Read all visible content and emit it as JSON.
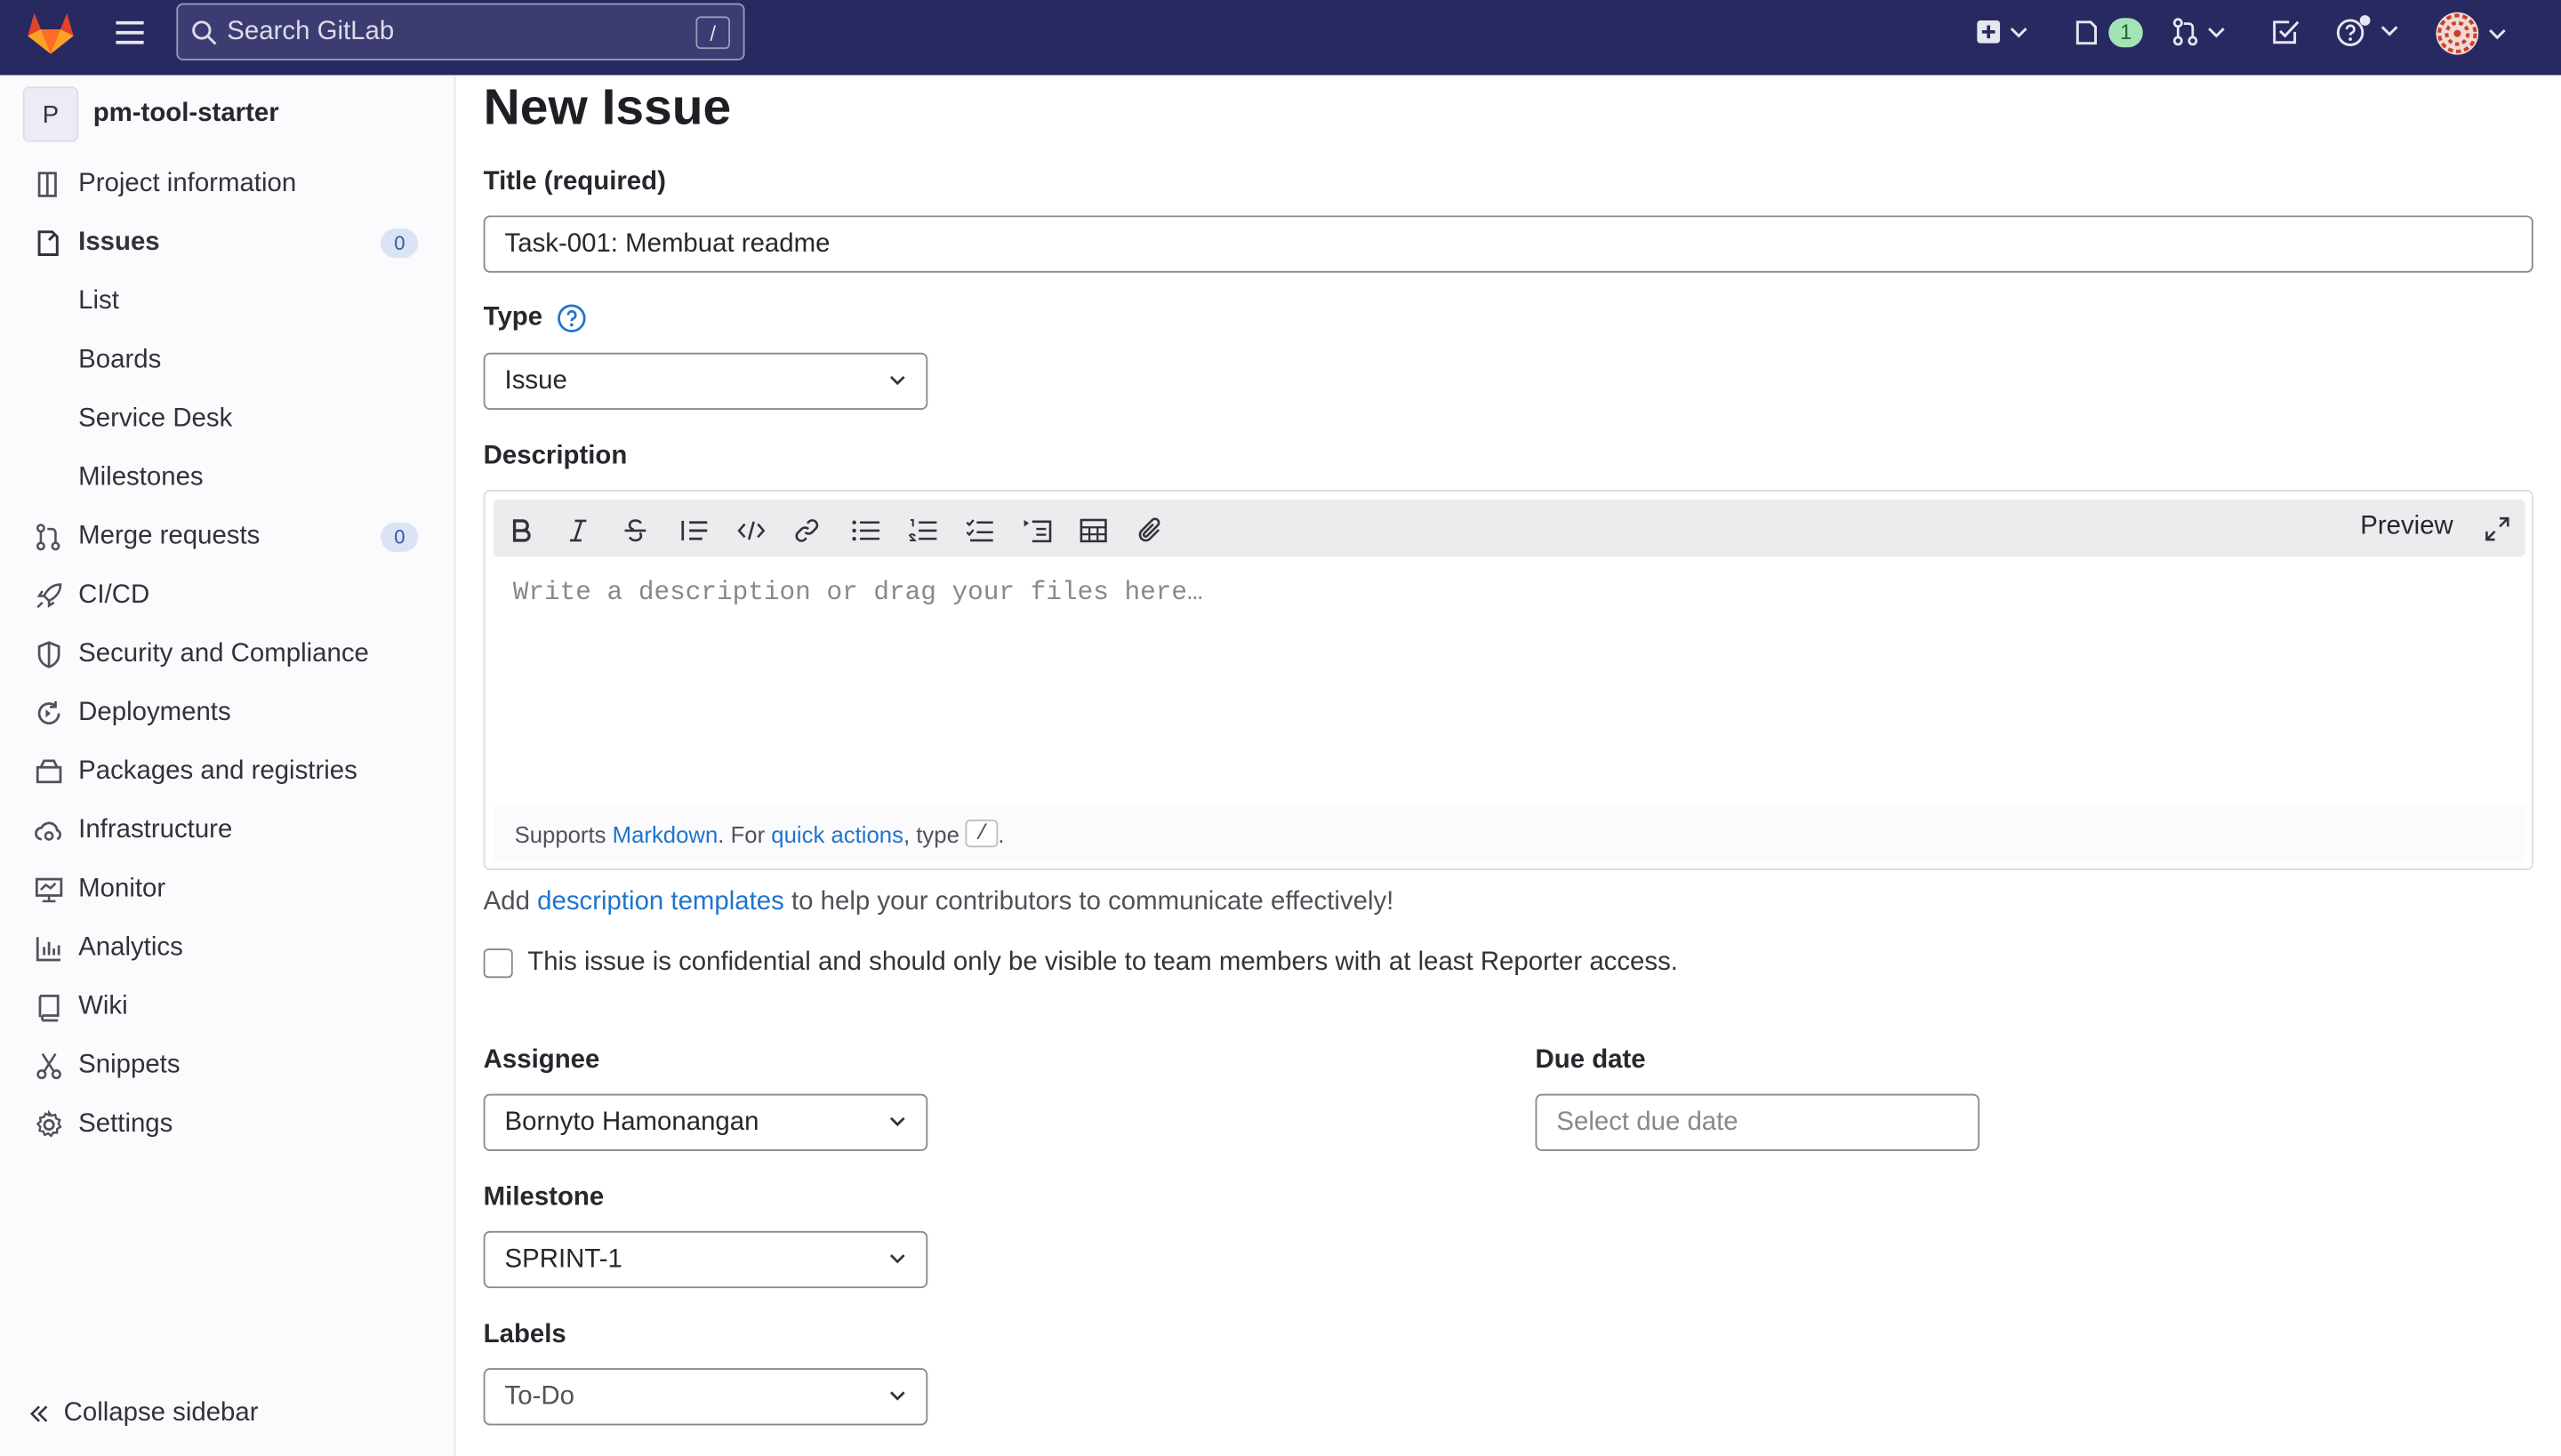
{
  "topbar": {
    "search_placeholder": "Search GitLab",
    "search_shortcut": "/",
    "issues_count": "1"
  },
  "sidebar": {
    "project_initial": "P",
    "project_name": "pm-tool-starter",
    "items": [
      {
        "label": "Project information",
        "icon": "project-info-icon"
      },
      {
        "label": "Issues",
        "icon": "issues-icon",
        "count": "0"
      },
      {
        "label": "List"
      },
      {
        "label": "Boards"
      },
      {
        "label": "Service Desk"
      },
      {
        "label": "Milestones"
      },
      {
        "label": "Merge requests",
        "icon": "merge-request-icon",
        "count": "0"
      },
      {
        "label": "CI/CD",
        "icon": "rocket-icon"
      },
      {
        "label": "Security and Compliance",
        "icon": "shield-icon"
      },
      {
        "label": "Deployments",
        "icon": "deployments-icon"
      },
      {
        "label": "Packages and registries",
        "icon": "package-icon"
      },
      {
        "label": "Infrastructure",
        "icon": "cloud-gear-icon"
      },
      {
        "label": "Monitor",
        "icon": "monitor-icon"
      },
      {
        "label": "Analytics",
        "icon": "chart-icon"
      },
      {
        "label": "Wiki",
        "icon": "book-icon"
      },
      {
        "label": "Snippets",
        "icon": "scissors-icon"
      },
      {
        "label": "Settings",
        "icon": "gear-icon"
      }
    ],
    "collapse_label": "Collapse sidebar"
  },
  "main": {
    "page_title": "New Issue",
    "title_label": "Title (required)",
    "title_value": "Task-001: Membuat readme",
    "type_label": "Type",
    "type_value": "Issue",
    "description_label": "Description",
    "preview_label": "Preview",
    "description_placeholder": "Write a description or drag your files here…",
    "supports_prefix": "Supports ",
    "markdown_link": "Markdown",
    "for_text": ". For ",
    "quick_actions_link": "quick actions",
    "type_text": ", type ",
    "slash_key": "/",
    "period": ".",
    "add_text": "Add ",
    "templates_link": "description templates",
    "templates_suffix": " to help your contributors to communicate effectively!",
    "confidential_label": "This issue is confidential and should only be visible to team members with at least Reporter access.",
    "assignee_label": "Assignee",
    "assignee_value": "Bornyto Hamonangan",
    "due_date_label": "Due date",
    "due_date_placeholder": "Select due date",
    "milestone_label": "Milestone",
    "milestone_value": "SPRINT-1",
    "labels_label": "Labels",
    "labels_value": "To-Do"
  },
  "colors": {
    "topbar": "#292961",
    "link": "#1f75cb",
    "sidebar_bg": "#fbfafd"
  }
}
